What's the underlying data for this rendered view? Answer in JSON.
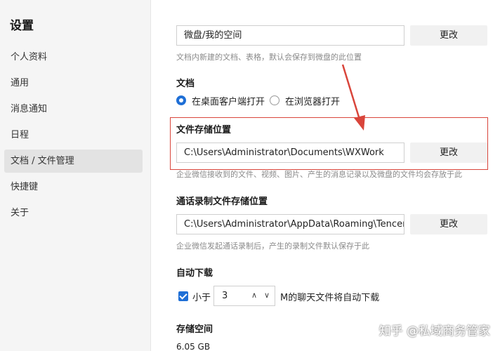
{
  "sidebar": {
    "title": "设置",
    "items": [
      {
        "label": "个人资料"
      },
      {
        "label": "通用"
      },
      {
        "label": "消息通知"
      },
      {
        "label": "日程"
      },
      {
        "label": "文档 / 文件管理"
      },
      {
        "label": "快捷键"
      },
      {
        "label": "关于"
      }
    ],
    "active_index": 4
  },
  "doc_location": {
    "value": "微盘/我的空间",
    "button": "更改",
    "hint": "文档内新建的文档、表格，默认会保存到微盘的此位置"
  },
  "doc_open": {
    "title": "文档",
    "option_desktop": "在桌面客户端打开",
    "option_browser": "在浏览器打开",
    "selected": "desktop"
  },
  "file_storage": {
    "title": "文件存储位置",
    "value": "C:\\Users\\Administrator\\Documents\\WXWork",
    "button": "更改",
    "hint": "企业微信接收到的文件、视频、图片、产生的消息记录以及微盘的文件均会存放于此"
  },
  "call_recording": {
    "title": "通话录制文件存储位置",
    "value": "C:\\Users\\Administrator\\AppData\\Roaming\\Tencent\\...",
    "button": "更改",
    "hint": "企业微信发起通话录制后，产生的录制文件默认保存于此"
  },
  "auto_download": {
    "title": "自动下载",
    "checked": true,
    "prefix": "小于",
    "value": "3",
    "suffix": "M的聊天文件将自动下载"
  },
  "storage": {
    "title": "存储空间",
    "used": "6.05 GB"
  },
  "watermark": "知乎 @私域商务管家",
  "colors": {
    "accent": "#1f6fd6",
    "annotation": "#d9453b"
  }
}
